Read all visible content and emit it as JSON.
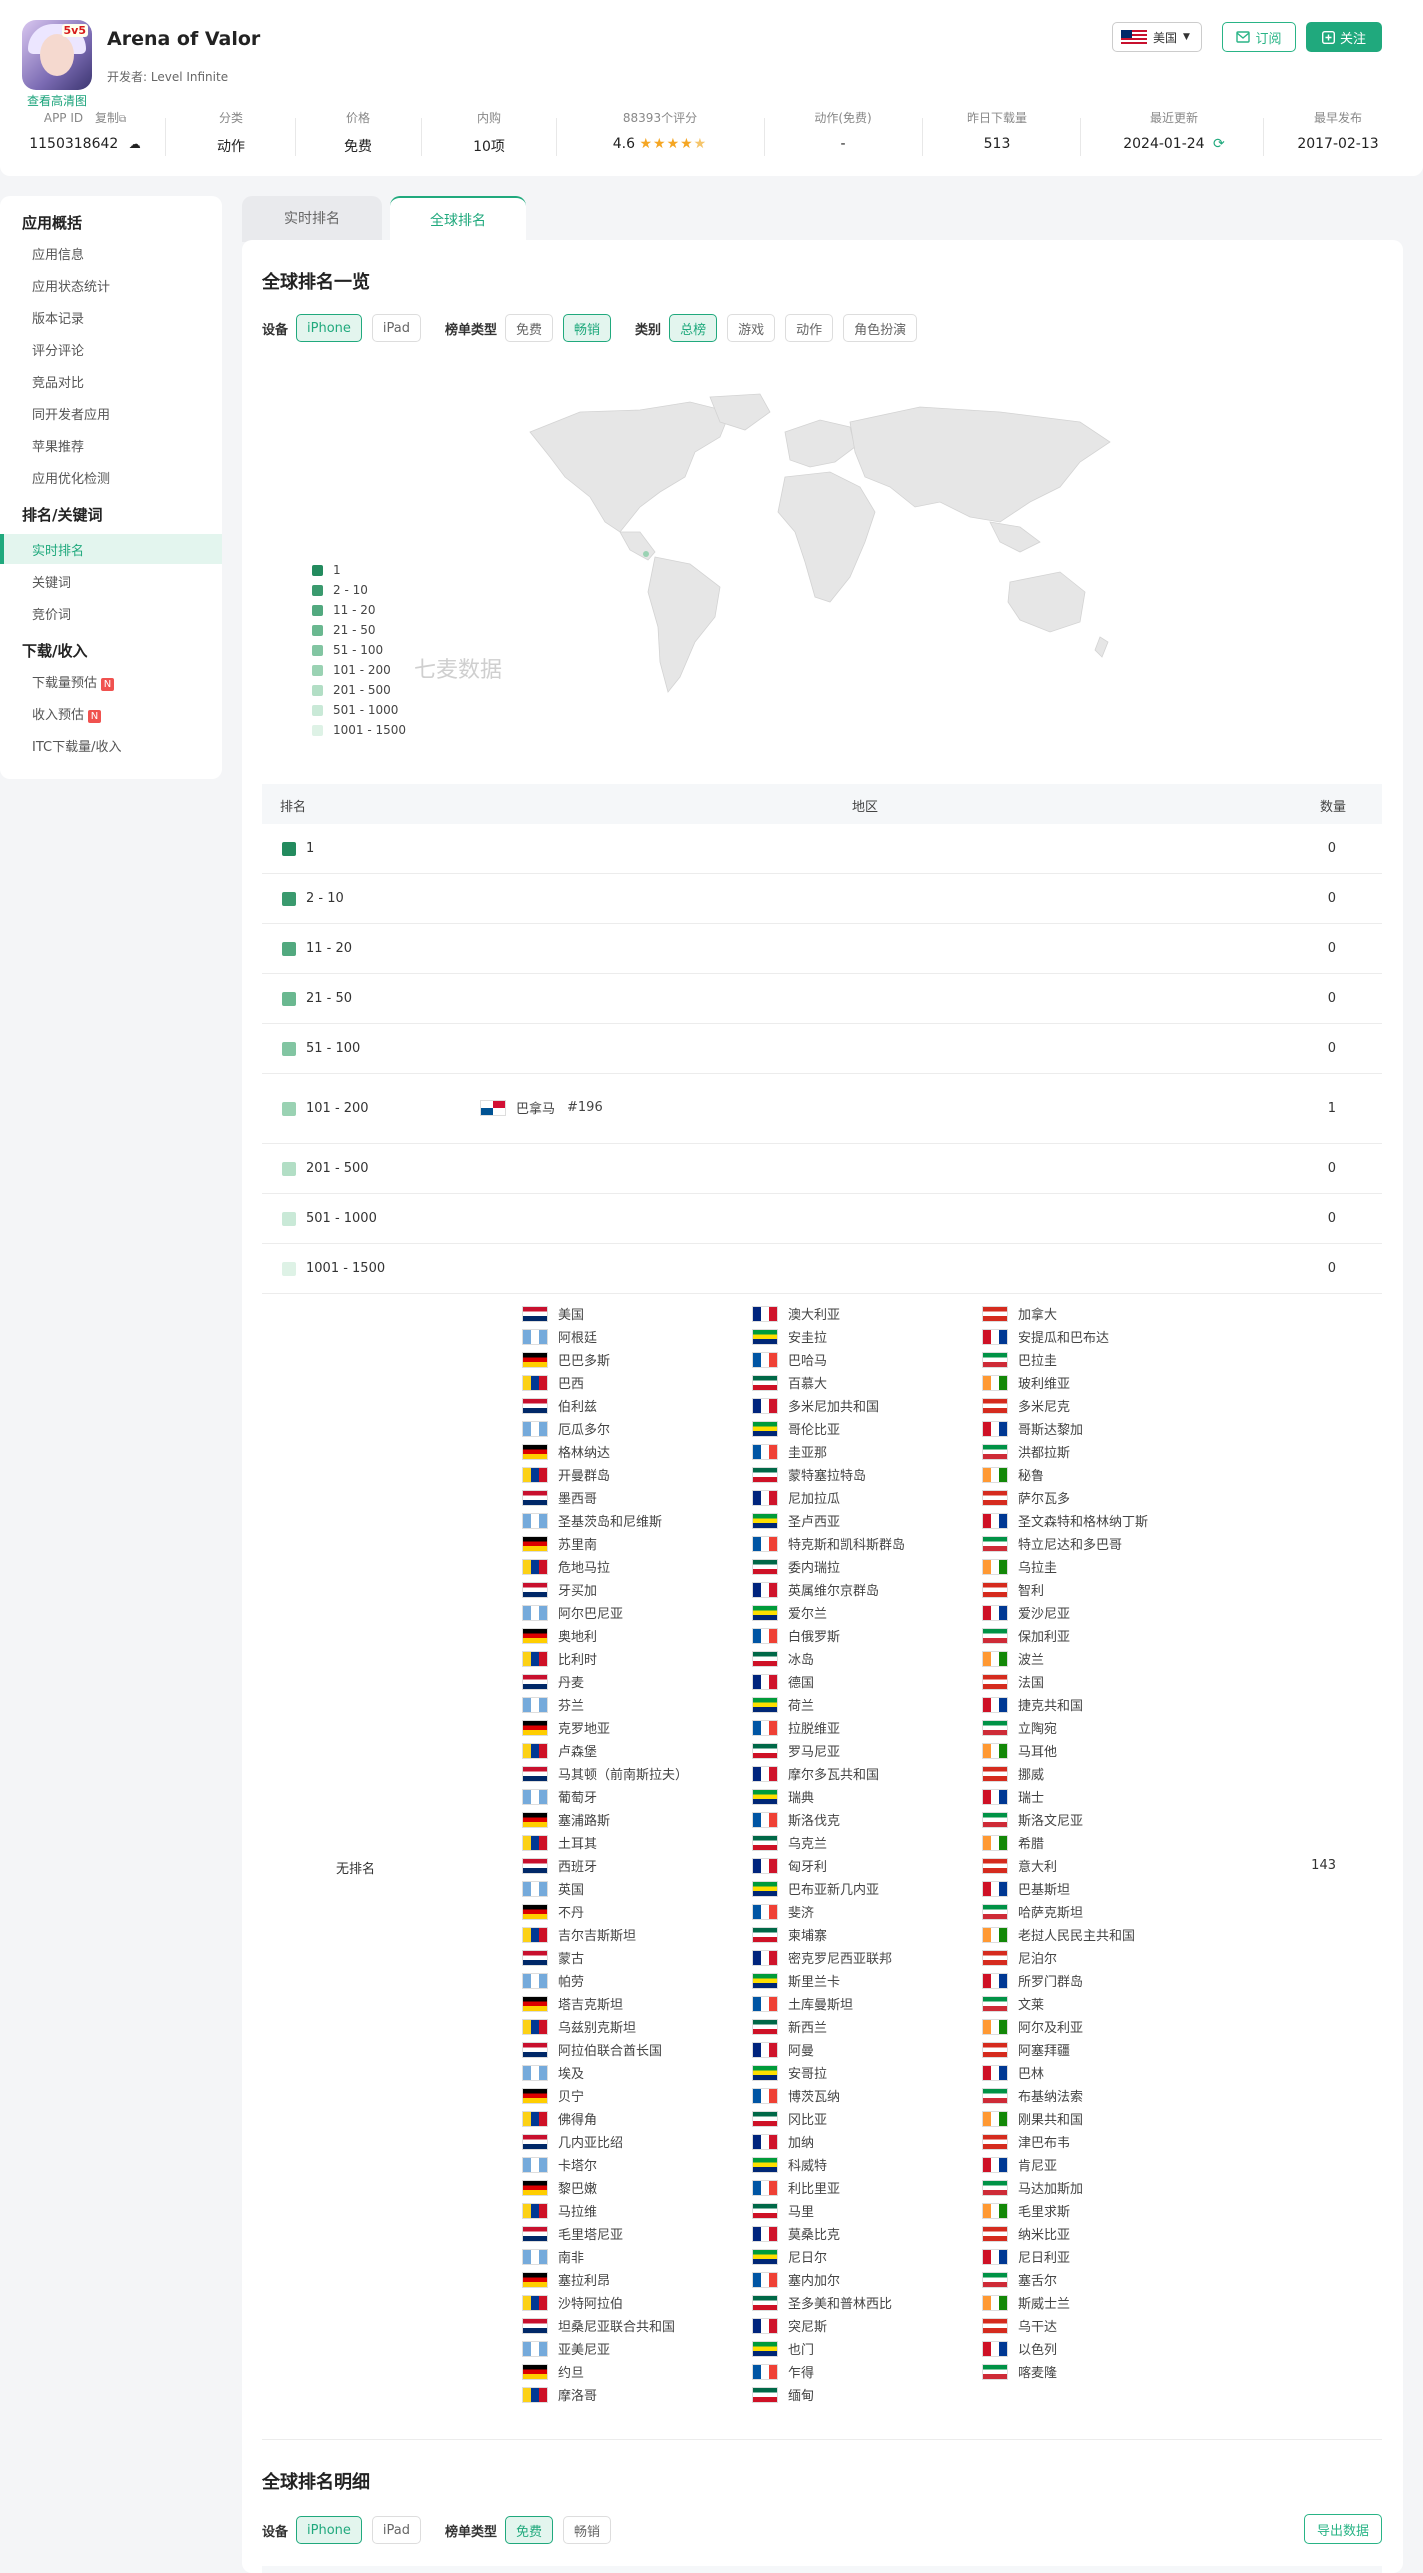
{
  "app": {
    "name": "Arena of Valor",
    "developer": "开发者: Level Infinite",
    "view_hd": "查看高清图",
    "icon_badge": "5v5"
  },
  "header": {
    "region": "美国",
    "subscribe": "订阅",
    "follow": "关注"
  },
  "stats": [
    {
      "key": "APP ID",
      "key2": "复制",
      "value": "1150318642"
    },
    {
      "key": "分类",
      "value": "动作"
    },
    {
      "key": "价格",
      "value": "免费"
    },
    {
      "key": "内购",
      "value": "10项"
    },
    {
      "key": "88393个评分",
      "value": "4.6",
      "stars": 4.6
    },
    {
      "key": "动作(免费)",
      "value": "-"
    },
    {
      "key": "昨日下载量",
      "value": "513"
    },
    {
      "key": "最近更新",
      "value": "2024-01-24"
    },
    {
      "key": "最早发布",
      "value": "2017-02-13"
    }
  ],
  "sidebar": {
    "sec1": "应用概括",
    "sec1_items": [
      "应用信息",
      "应用状态统计",
      "版本记录",
      "评分评论",
      "竞品对比",
      "同开发者应用",
      "苹果推荐",
      "应用优化检测"
    ],
    "sec2": "排名/关键词",
    "sec2_items": [
      "实时排名",
      "关键词",
      "竞价词"
    ],
    "sec3": "下载/收入",
    "sec3_items": [
      "下载量预估",
      "收入预估",
      "ITC下载量/收入"
    ],
    "badge": "N"
  },
  "tabs": [
    "实时排名",
    "全球排名"
  ],
  "overview": {
    "title": "全球排名一览",
    "device_label": "设备",
    "devices": [
      "iPhone",
      "iPad"
    ],
    "list_label": "榜单类型",
    "lists": [
      "免费",
      "畅销"
    ],
    "cat_label": "类别",
    "cats": [
      "总榜",
      "游戏",
      "动作",
      "角色扮演"
    ],
    "watermark": "七麦数据"
  },
  "legend": [
    {
      "label": "1",
      "color": "#238b5e"
    },
    {
      "label": "2 - 10",
      "color": "#3a9a6e"
    },
    {
      "label": "11 - 20",
      "color": "#52a97f"
    },
    {
      "label": "21 - 50",
      "color": "#6ab890"
    },
    {
      "label": "51 - 100",
      "color": "#82c5a2"
    },
    {
      "label": "101 - 200",
      "color": "#9ad2b3"
    },
    {
      "label": "201 - 500",
      "color": "#b2dec5"
    },
    {
      "label": "501 - 1000",
      "color": "#c9e9d7"
    },
    {
      "label": "1001 - 1500",
      "color": "#def2e6"
    }
  ],
  "table": {
    "headers": [
      "排名",
      "地区",
      "数量"
    ],
    "rows": [
      {
        "label": "1",
        "count": "0"
      },
      {
        "label": "2 - 10",
        "count": "0"
      },
      {
        "label": "11 - 20",
        "count": "0"
      },
      {
        "label": "21 - 50",
        "count": "0"
      },
      {
        "label": "51 - 100",
        "count": "0"
      },
      {
        "label": "101 - 200",
        "count": "1",
        "region": "巴拿马",
        "rank": "#196"
      },
      {
        "label": "201 - 500",
        "count": "0"
      },
      {
        "label": "501 - 1000",
        "count": "0"
      },
      {
        "label": "1001 - 1500",
        "count": "0"
      }
    ],
    "unranked_label": "无排名",
    "unranked_count": "143",
    "countries": [
      "美国",
      "澳大利亚",
      "加拿大",
      "阿根廷",
      "安圭拉",
      "安提瓜和巴布达",
      "巴巴多斯",
      "巴哈马",
      "巴拉圭",
      "巴西",
      "百慕大",
      "玻利维亚",
      "伯利兹",
      "多米尼加共和国",
      "多米尼克",
      "厄瓜多尔",
      "哥伦比亚",
      "哥斯达黎加",
      "格林纳达",
      "圭亚那",
      "洪都拉斯",
      "开曼群岛",
      "蒙特塞拉特岛",
      "秘鲁",
      "墨西哥",
      "尼加拉瓜",
      "萨尔瓦多",
      "圣基茨岛和尼维斯",
      "圣卢西亚",
      "圣文森特和格林纳丁斯",
      "苏里南",
      "特克斯和凯科斯群岛",
      "特立尼达和多巴哥",
      "危地马拉",
      "委内瑞拉",
      "乌拉圭",
      "牙买加",
      "英属维尔京群岛",
      "智利",
      "阿尔巴尼亚",
      "爱尔兰",
      "爱沙尼亚",
      "奥地利",
      "白俄罗斯",
      "保加利亚",
      "比利时",
      "冰岛",
      "波兰",
      "丹麦",
      "德国",
      "法国",
      "芬兰",
      "荷兰",
      "捷克共和国",
      "克罗地亚",
      "拉脱维亚",
      "立陶宛",
      "卢森堡",
      "罗马尼亚",
      "马耳他",
      "马其顿（前南斯拉夫）",
      "摩尔多瓦共和国",
      "挪威",
      "葡萄牙",
      "瑞典",
      "瑞士",
      "塞浦路斯",
      "斯洛伐克",
      "斯洛文尼亚",
      "土耳其",
      "乌克兰",
      "希腊",
      "西班牙",
      "匈牙利",
      "意大利",
      "英国",
      "巴布亚新几内亚",
      "巴基斯坦",
      "不丹",
      "斐济",
      "哈萨克斯坦",
      "吉尔吉斯斯坦",
      "柬埔寨",
      "老挝人民民主共和国",
      "蒙古",
      "密克罗尼西亚联邦",
      "尼泊尔",
      "帕劳",
      "斯里兰卡",
      "所罗门群岛",
      "塔吉克斯坦",
      "土库曼斯坦",
      "文莱",
      "乌兹别克斯坦",
      "新西兰",
      "阿尔及利亚",
      "阿拉伯联合酋长国",
      "阿曼",
      "阿塞拜疆",
      "埃及",
      "安哥拉",
      "巴林",
      "贝宁",
      "博茨瓦纳",
      "布基纳法索",
      "佛得角",
      "冈比亚",
      "刚果共和国",
      "几内亚比绍",
      "加纳",
      "津巴布韦",
      "卡塔尔",
      "科威特",
      "肯尼亚",
      "黎巴嫩",
      "利比里亚",
      "马达加斯加",
      "马拉维",
      "马里",
      "毛里求斯",
      "毛里塔尼亚",
      "莫桑比克",
      "纳米比亚",
      "南非",
      "尼日尔",
      "尼日利亚",
      "塞拉利昂",
      "塞内加尔",
      "塞舌尔",
      "沙特阿拉伯",
      "圣多美和普林西比",
      "斯威士兰",
      "坦桑尼亚联合共和国",
      "突尼斯",
      "乌干达",
      "亚美尼亚",
      "也门",
      "以色列",
      "约旦",
      "乍得",
      "喀麦隆",
      "摩洛哥",
      "缅甸"
    ]
  },
  "detail": {
    "title": "全球排名明细",
    "device_label": "设备",
    "devices": [
      "iPhone",
      "iPad"
    ],
    "list_label": "榜单类型",
    "lists": [
      "免费",
      "畅销"
    ],
    "export": "导出数据"
  }
}
